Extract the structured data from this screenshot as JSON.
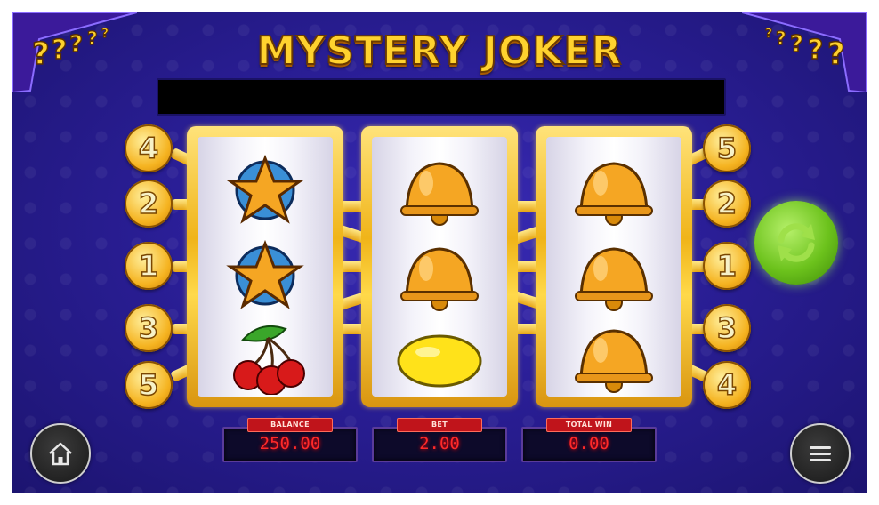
{
  "game": {
    "title": "MYSTERY JOKER",
    "message": ""
  },
  "reels": [
    {
      "symbols": [
        "star",
        "star",
        "cherries"
      ]
    },
    {
      "symbols": [
        "bell",
        "bell",
        "lemon"
      ]
    },
    {
      "symbols": [
        "bell",
        "bell",
        "bell"
      ]
    }
  ],
  "paylines": {
    "left": [
      "4",
      "2",
      "1",
      "3",
      "5"
    ],
    "right": [
      "5",
      "2",
      "1",
      "3",
      "4"
    ]
  },
  "panels": {
    "balance": {
      "label": "BALANCE",
      "value": "250.00"
    },
    "bet": {
      "label": "BET",
      "value": "2.00"
    },
    "total_win": {
      "label": "TOTAL WIN",
      "value": "0.00"
    }
  },
  "buttons": {
    "spin_icon": "refresh-icon",
    "home_icon": "home-icon",
    "menu_icon": "hamburger-menu-icon"
  },
  "colors": {
    "background": "#2a1e96",
    "reel_frame": "#f0b419",
    "spin_button": "#6cc21c",
    "display_text": "#ff2a2a",
    "label_bg": "#c0141b"
  }
}
